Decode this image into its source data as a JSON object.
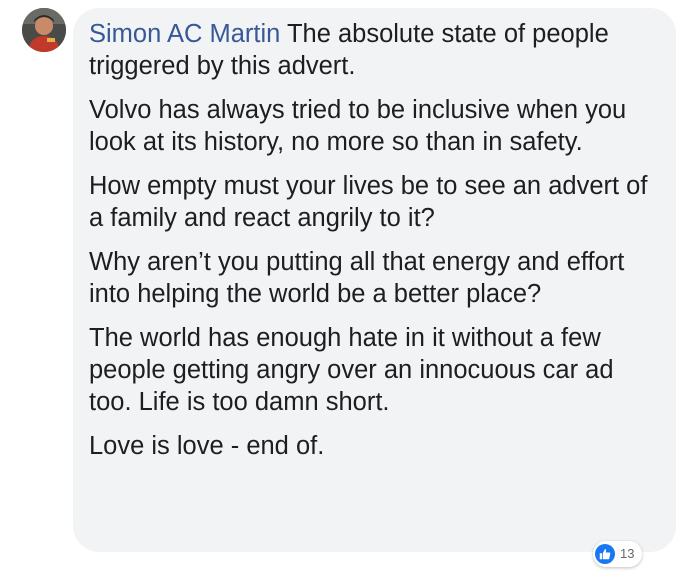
{
  "comment": {
    "author": "Simon AC Martin",
    "paragraphs": [
      "The absolute state of people triggered by this advert.",
      "Volvo has always tried to be inclusive when you look at its history, no more so than in safety.",
      "How empty must your lives be to see an advert of a family and react angrily to it?",
      "Why aren’t you putting all that energy and effort into helping the world be a better place?",
      "The world has enough hate in it without a few people getting angry over an innocuous car ad too. Life is too damn short.",
      "Love is love - end of."
    ],
    "reactions": {
      "icon": "like-icon",
      "count": "13"
    }
  },
  "colors": {
    "author_link": "#385898",
    "bubble_bg": "#f2f3f5",
    "text": "#1c1e21",
    "like_blue": "#1877f2"
  }
}
